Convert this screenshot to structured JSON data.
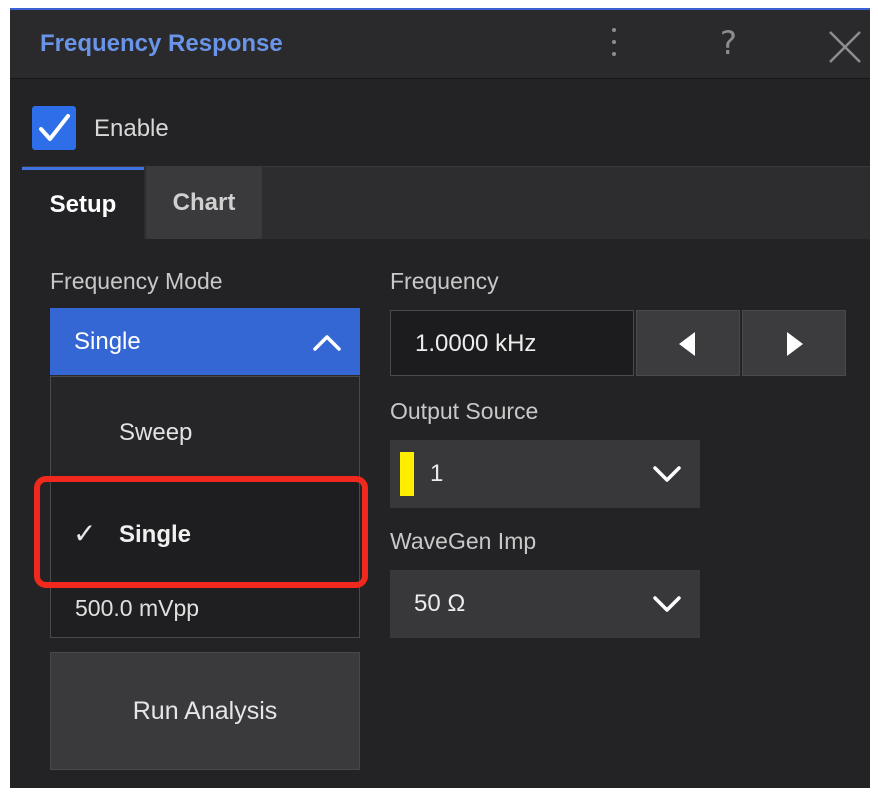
{
  "window": {
    "title": "Frequency Response"
  },
  "enable": {
    "label": "Enable",
    "checked": true
  },
  "tabs": [
    {
      "label": "Setup",
      "active": true
    },
    {
      "label": "Chart",
      "active": false
    }
  ],
  "frequency_mode": {
    "label": "Frequency Mode",
    "selected": "Single",
    "options": [
      "Sweep",
      "Single"
    ],
    "check_glyph": "✓"
  },
  "amplitude": {
    "value": "500.0 mVpp"
  },
  "run_button": {
    "label": "Run Analysis"
  },
  "frequency": {
    "label": "Frequency",
    "value": "1.0000 kHz"
  },
  "output_source": {
    "label": "Output Source",
    "value": "1",
    "swatch_color": "#ffee00"
  },
  "wavegen_imp": {
    "label": "WaveGen Imp",
    "value": "50 Ω"
  },
  "colors": {
    "accent": "#3466d4",
    "title": "#6a94e8",
    "highlight": "#f0281e",
    "background": "#232325"
  }
}
